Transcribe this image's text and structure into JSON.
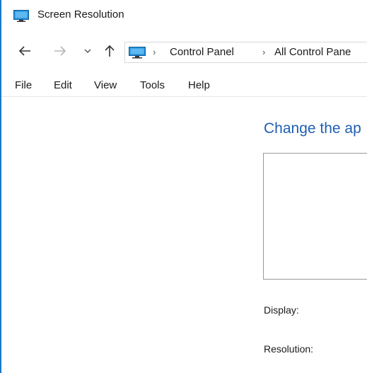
{
  "window": {
    "title": "Screen Resolution",
    "accent_color": "#1979ca"
  },
  "nav": {
    "back_icon": "arrow-left-icon",
    "forward_icon": "arrow-right-icon",
    "recent_icon": "chevron-down-icon",
    "up_icon": "arrow-up-icon",
    "address": {
      "location_icon": "monitor-icon",
      "breadcrumbs": [
        "Control Panel",
        "All Control Pane"
      ],
      "separator": "›"
    }
  },
  "menu": {
    "items": [
      "File",
      "Edit",
      "View",
      "Tools",
      "Help"
    ]
  },
  "main": {
    "heading": "Change the ap",
    "heading_color": "#1e5fb4",
    "display_label": "Display:",
    "resolution_label": "Resolution:"
  }
}
